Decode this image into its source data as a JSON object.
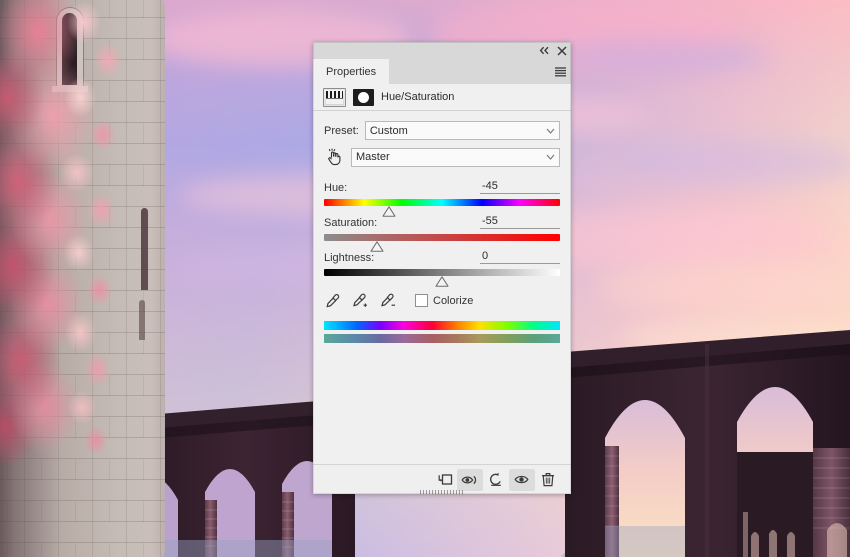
{
  "scene": {
    "description": "Fantasy castle tower with pink flowering vines and gothic aqueduct arches against a pink-purple sunset sky"
  },
  "panel": {
    "titlebar": {
      "collapse_icon": "double-chevron-left-icon",
      "close_icon": "close-icon"
    },
    "tab": {
      "label": "Properties",
      "menu_icon": "panel-menu-icon"
    },
    "adjustment": {
      "title": "Hue/Saturation",
      "layer_icon": "adjustment-layer-icon",
      "mask_icon": "layer-mask-icon"
    },
    "preset": {
      "label": "Preset:",
      "value": "Custom",
      "chevron_icon": "chevron-down-icon"
    },
    "channel": {
      "targeted_adjustment_icon": "targeted-adjustment-hand-icon",
      "value": "Master",
      "chevron_icon": "chevron-down-icon"
    },
    "sliders": [
      {
        "label": "Hue:",
        "value": "-45",
        "percent": 27.5,
        "track": "hue"
      },
      {
        "label": "Saturation:",
        "value": "-55",
        "percent": 22.5,
        "track": "saturation"
      },
      {
        "label": "Lightness:",
        "value": "0",
        "percent": 50.0,
        "track": "lightness"
      }
    ],
    "tools": {
      "eyedropper_icon": "eyedropper-icon",
      "eyedropper_add_icon": "eyedropper-add-icon",
      "eyedropper_subtract_icon": "eyedropper-subtract-icon",
      "colorize_label": "Colorize",
      "colorize_checked": false
    },
    "spectrum": {
      "input_bar": "input-color-spectrum",
      "output_bar": "output-color-spectrum"
    },
    "footer": {
      "buttons": [
        {
          "name": "clip-to-layer-button",
          "icon": "clip-to-layer-icon",
          "active": false
        },
        {
          "name": "view-previous-button",
          "icon": "eye-previous-icon",
          "active": true
        },
        {
          "name": "reset-button",
          "icon": "reset-arrow-icon",
          "active": false
        },
        {
          "name": "toggle-visibility-button",
          "icon": "eye-icon",
          "active": true
        },
        {
          "name": "delete-button",
          "icon": "trash-icon",
          "active": false
        }
      ],
      "resize_grip_icon": "resize-grip-icon"
    },
    "colors": {
      "panel_bg": "#f0f0f0",
      "tabstrip_bg": "#d8d8d8",
      "text": "#2b2b2b",
      "border": "#b9b9b9"
    }
  }
}
